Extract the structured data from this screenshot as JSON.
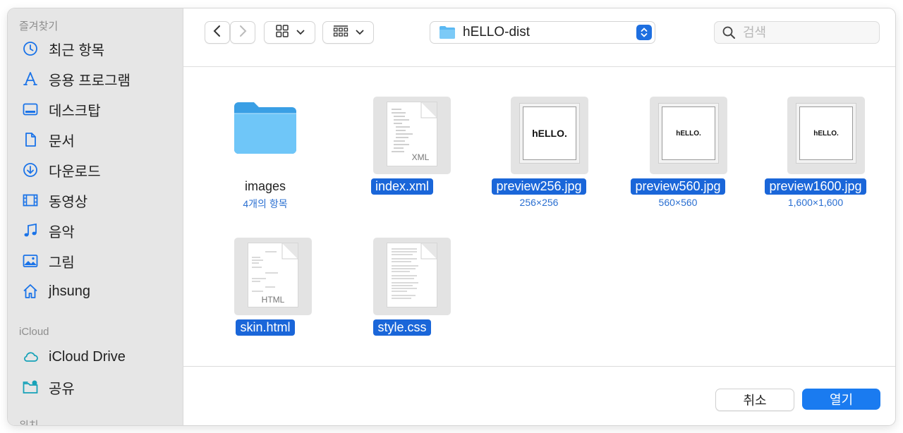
{
  "sidebar": {
    "favorites_header": "즐겨찾기",
    "favorites": [
      {
        "label": "최근 항목",
        "icon": "clock-icon"
      },
      {
        "label": "응용 프로그램",
        "icon": "applications-icon"
      },
      {
        "label": "데스크탑",
        "icon": "desktop-icon"
      },
      {
        "label": "문서",
        "icon": "document-icon"
      },
      {
        "label": "다운로드",
        "icon": "download-icon"
      },
      {
        "label": "동영상",
        "icon": "film-icon"
      },
      {
        "label": "음악",
        "icon": "music-note-icon"
      },
      {
        "label": "그림",
        "icon": "photo-icon"
      },
      {
        "label": "jhsung",
        "icon": "home-icon"
      }
    ],
    "icloud_header": "iCloud",
    "icloud": [
      {
        "label": "iCloud Drive",
        "icon": "cloud-icon"
      },
      {
        "label": "공유",
        "icon": "shared-folder-icon"
      }
    ],
    "locations_header": "위치"
  },
  "toolbar": {
    "current_folder": "hELLO-dist",
    "search_placeholder": "검색"
  },
  "files": [
    {
      "name": "images",
      "sub": "4개의 항목",
      "kind": "folder",
      "selected": false
    },
    {
      "name": "index.xml",
      "sub": "",
      "kind": "xml",
      "badge": "XML",
      "selected": true
    },
    {
      "name": "preview256.jpg",
      "sub": "256×256",
      "kind": "image",
      "preview_text": "hELLO.",
      "selected": true
    },
    {
      "name": "preview560.jpg",
      "sub": "560×560",
      "kind": "image",
      "preview_text": "hELLO.",
      "selected": true
    },
    {
      "name": "preview1600.jpg",
      "sub": "1,600×1,600",
      "kind": "image",
      "preview_text": "hELLO.",
      "selected": true
    },
    {
      "name": "skin.html",
      "sub": "",
      "kind": "html",
      "badge": "HTML",
      "selected": true
    },
    {
      "name": "style.css",
      "sub": "",
      "kind": "css",
      "selected": true
    }
  ],
  "footer": {
    "cancel_label": "취소",
    "open_label": "열기"
  },
  "colors": {
    "accent": "#1a7bf0",
    "selection": "#1a66d9",
    "folder": "#5bb9f3",
    "sidebar_bg": "#e6e6e6"
  }
}
